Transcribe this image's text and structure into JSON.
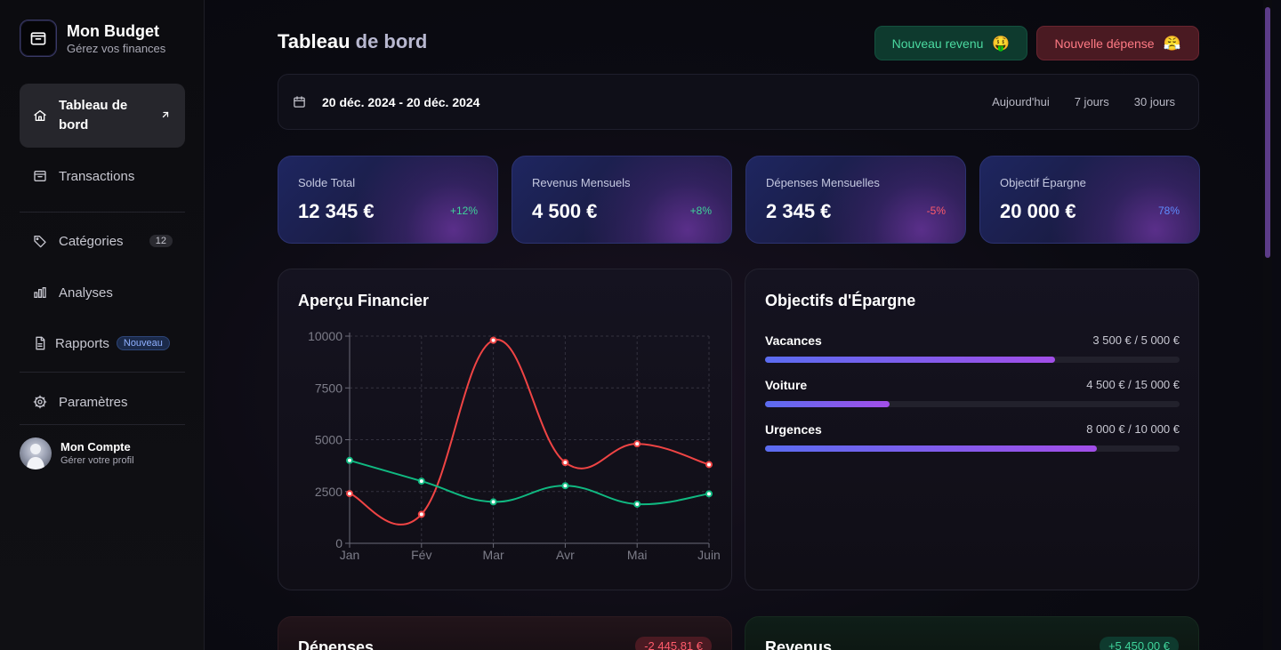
{
  "brand": {
    "title": "Mon Budget",
    "subtitle": "Gérez vos finances"
  },
  "sidebar": {
    "items": [
      {
        "label": "Tableau de bord",
        "icon": "home-icon"
      },
      {
        "label": "Transactions",
        "icon": "inbox-icon"
      },
      {
        "label": "Catégories",
        "icon": "tag-icon",
        "count": "12"
      },
      {
        "label": "Analyses",
        "icon": "bar-chart-icon"
      },
      {
        "label": "Rapports",
        "icon": "document-icon",
        "badge": "Nouveau"
      },
      {
        "label": "Paramètres",
        "icon": "gear-icon"
      }
    ],
    "account": {
      "name": "Mon Compte",
      "subtitle": "Gérer votre profil"
    }
  },
  "header": {
    "title_main": "Tableau",
    "title_dim": " de bord",
    "new_income_label": "Nouveau revenu",
    "new_income_emoji": "🤑",
    "new_expense_label": "Nouvelle dépense",
    "new_expense_emoji": "😤"
  },
  "datebar": {
    "range": "20 déc. 2024 - 20 déc. 2024",
    "quick": [
      "Aujourd'hui",
      "7 jours",
      "30 jours"
    ]
  },
  "stats": [
    {
      "label": "Solde Total",
      "value": "12 345 €",
      "delta": "+12%",
      "delta_color": "#3fd39a"
    },
    {
      "label": "Revenus Mensuels",
      "value": "4 500 €",
      "delta": "+8%",
      "delta_color": "#3fd39a"
    },
    {
      "label": "Dépenses Mensuelles",
      "value": "2 345 €",
      "delta": "-5%",
      "delta_color": "#ff5b6b"
    },
    {
      "label": "Objectif Épargne",
      "value": "20 000 €",
      "delta": "78%",
      "delta_color": "#5f8cff"
    }
  ],
  "overview": {
    "title": "Aperçu Financier"
  },
  "chart_data": {
    "type": "line",
    "title": "Aperçu Financier",
    "categories": [
      "Jan",
      "Fév",
      "Mar",
      "Avr",
      "Mai",
      "Juin"
    ],
    "yticks": [
      "0",
      "2500",
      "5000",
      "7500",
      "10000"
    ],
    "ylim": [
      0,
      10000
    ],
    "grid": true,
    "series": [
      {
        "color": "#ef4444",
        "values": [
          2400,
          1400,
          9800,
          3900,
          4800,
          3800
        ]
      },
      {
        "color": "#10b981",
        "values": [
          4000,
          3000,
          2000,
          2780,
          1890,
          2390
        ]
      }
    ]
  },
  "savings": {
    "title": "Objectifs d'Épargne",
    "goals": [
      {
        "name": "Vacances",
        "amount": "3 500 € / 5 000 €",
        "progress": 0.7
      },
      {
        "name": "Voiture",
        "amount": "4 500 € / 15 000 €",
        "progress": 0.3
      },
      {
        "name": "Urgences",
        "amount": "8 000 € / 10 000 €",
        "progress": 0.8
      }
    ]
  },
  "bottom": {
    "expenses": {
      "title": "Dépenses",
      "amount": "-2 445,81 €"
    },
    "income": {
      "title": "Revenus",
      "amount": "+5 450,00 €"
    }
  }
}
